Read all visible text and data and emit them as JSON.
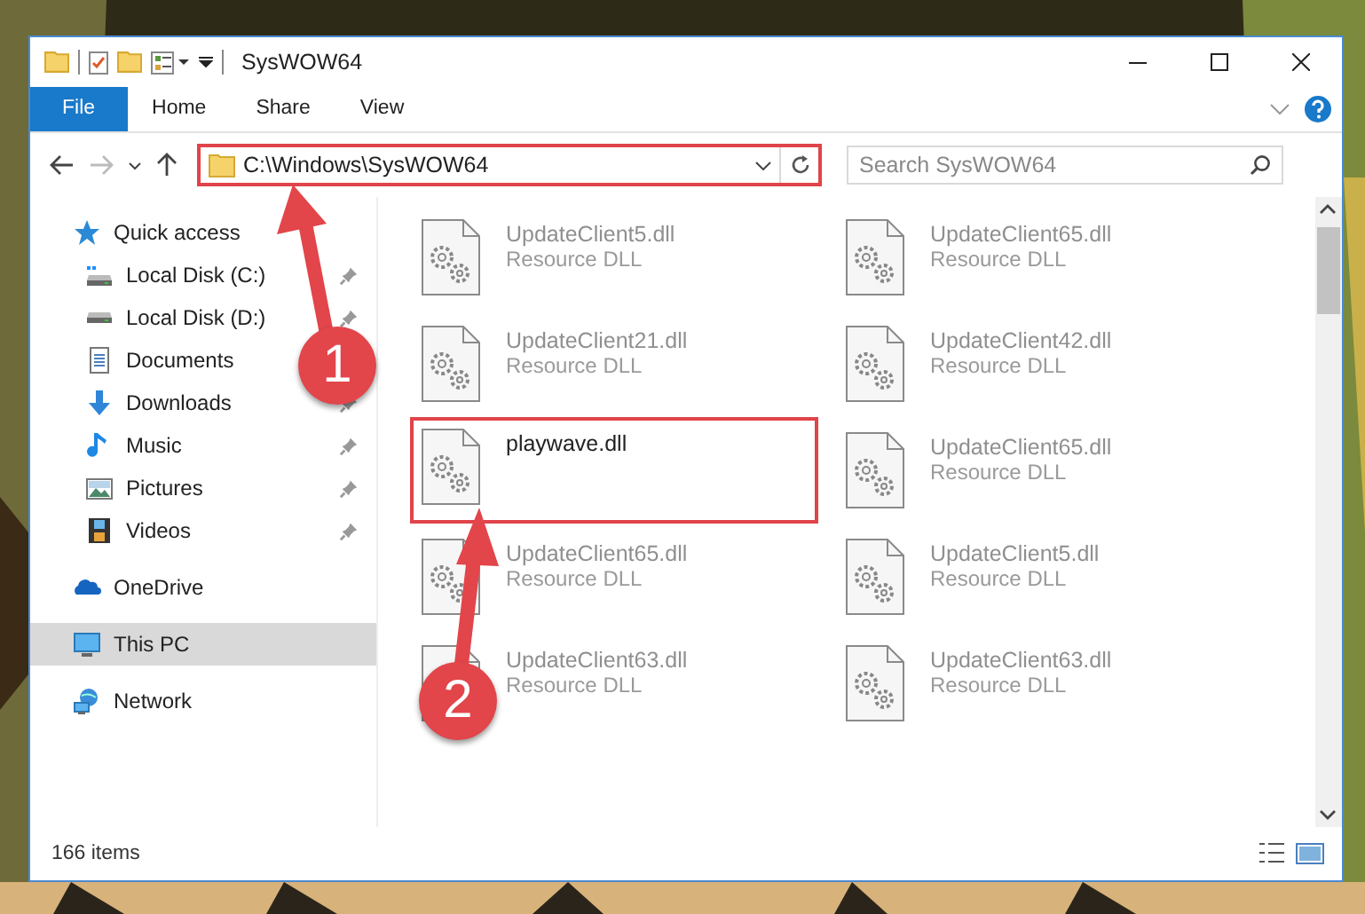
{
  "window": {
    "title": "SysWOW64"
  },
  "ribbon": {
    "tabs": [
      {
        "label": "File",
        "kind": "file"
      },
      {
        "label": "Home",
        "kind": "tab"
      },
      {
        "label": "Share",
        "kind": "tab"
      },
      {
        "label": "View",
        "kind": "tab"
      }
    ]
  },
  "address_bar": {
    "path": "C:\\Windows\\SysWOW64",
    "annotated": true
  },
  "search": {
    "placeholder": "Search SysWOW64"
  },
  "sidebar": {
    "items": [
      {
        "label": "Quick access",
        "kind": "quick",
        "selected": false,
        "children": [
          {
            "label": "Local Disk (C:)",
            "kind": "diskc",
            "pinned": true,
            "selected": false
          },
          {
            "label": "Local Disk (D:)",
            "kind": "disk",
            "pinned": true,
            "selected": false
          },
          {
            "label": "Documents",
            "kind": "documents",
            "selected": false
          },
          {
            "label": "Downloads",
            "kind": "downloads",
            "pinned": true,
            "selected": false
          },
          {
            "label": "Music",
            "kind": "music",
            "pinned": true,
            "selected": false
          },
          {
            "label": "Pictures",
            "kind": "pictures",
            "pinned": true,
            "selected": false
          },
          {
            "label": "Videos",
            "kind": "videos",
            "pinned": true,
            "selected": false
          }
        ]
      },
      {
        "label": "OneDrive",
        "kind": "cloud",
        "selected": false
      },
      {
        "label": "This PC",
        "kind": "pc",
        "selected": true
      },
      {
        "label": "Network",
        "kind": "network",
        "selected": false
      }
    ]
  },
  "files": [
    {
      "name": "UpdateClient5.dll",
      "type": "Resource DLL",
      "faded": true,
      "annotated": false
    },
    {
      "name": "UpdateClient65.dll",
      "type": "Resource DLL",
      "faded": true,
      "annotated": false
    },
    {
      "name": "UpdateClient21.dll",
      "type": "Resource DLL",
      "faded": true,
      "annotated": false
    },
    {
      "name": "UpdateClient42.dll",
      "type": "Resource DLL",
      "faded": true,
      "annotated": false
    },
    {
      "name": "playwave.dll",
      "faded": false,
      "annotated": true
    },
    {
      "name": "UpdateClient65.dll",
      "type": "Resource DLL",
      "faded": true,
      "annotated": false
    },
    {
      "name": "UpdateClient65.dll",
      "type": "Resource DLL",
      "faded": true,
      "annotated": false
    },
    {
      "name": "UpdateClient5.dll",
      "type": "Resource DLL",
      "faded": true,
      "annotated": false
    },
    {
      "name": "UpdateClient63.dll",
      "type": "Resource DLL",
      "faded": true,
      "annotated": false
    },
    {
      "name": "UpdateClient63.dll",
      "type": "Resource DLL",
      "faded": true,
      "annotated": false
    }
  ],
  "status_bar": {
    "count": "166 items"
  },
  "annotations": [
    {
      "number": "1"
    },
    {
      "number": "2"
    }
  ]
}
